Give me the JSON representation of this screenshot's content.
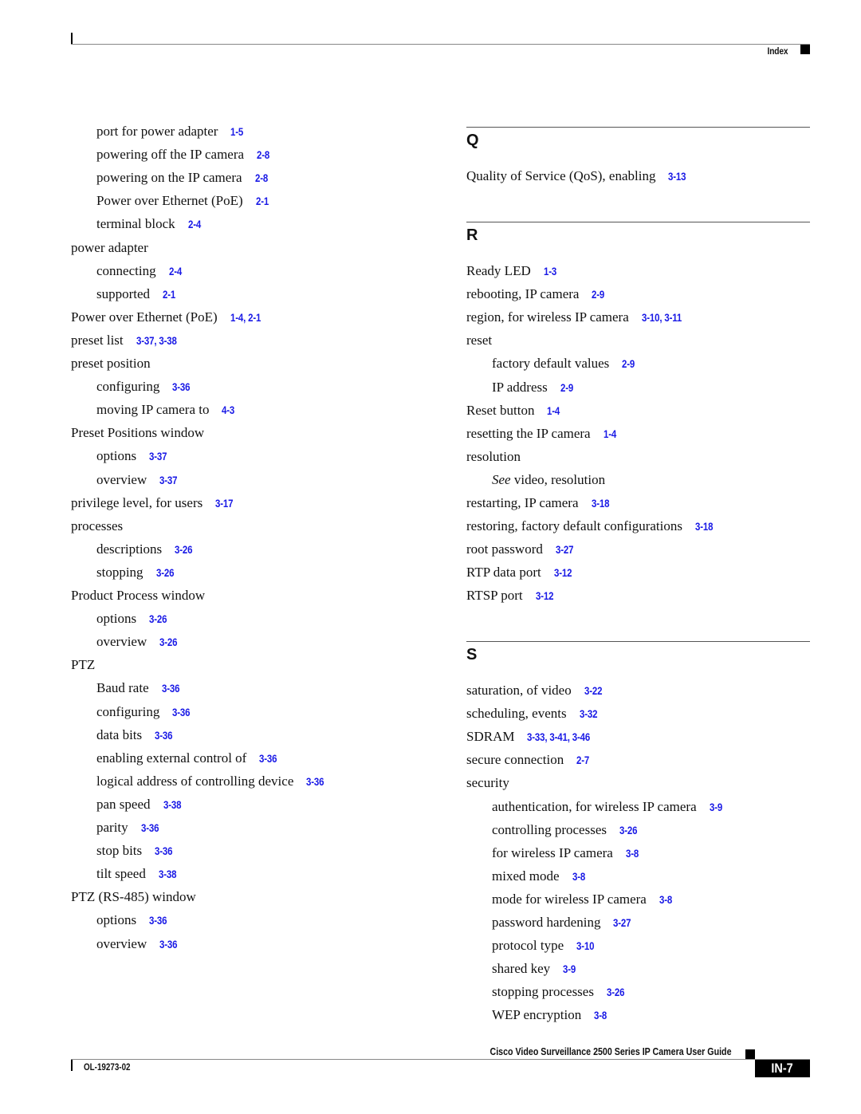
{
  "header": {
    "section_label": "Index"
  },
  "left_column": [
    {
      "text": "port for power adapter",
      "refs": "1-5",
      "level": 2
    },
    {
      "text": "powering off the IP camera",
      "refs": "2-8",
      "level": 2
    },
    {
      "text": "powering on the IP camera",
      "refs": "2-8",
      "level": 2
    },
    {
      "text": "Power over Ethernet (PoE)",
      "refs": "2-1",
      "level": 2
    },
    {
      "text": "terminal block",
      "refs": "2-4",
      "level": 2
    },
    {
      "text": "power adapter",
      "refs": "",
      "level": 1
    },
    {
      "text": "connecting",
      "refs": "2-4",
      "level": 2
    },
    {
      "text": "supported",
      "refs": "2-1",
      "level": 2
    },
    {
      "text": "Power over Ethernet (PoE)",
      "refs": "1-4, 2-1",
      "level": 1
    },
    {
      "text": "preset list",
      "refs": "3-37, 3-38",
      "level": 1
    },
    {
      "text": "preset position",
      "refs": "",
      "level": 1
    },
    {
      "text": "configuring",
      "refs": "3-36",
      "level": 2
    },
    {
      "text": "moving IP camera to",
      "refs": "4-3",
      "level": 2
    },
    {
      "text": "Preset Positions window",
      "refs": "",
      "level": 1
    },
    {
      "text": "options",
      "refs": "3-37",
      "level": 2
    },
    {
      "text": "overview",
      "refs": "3-37",
      "level": 2
    },
    {
      "text": "privilege level, for users",
      "refs": "3-17",
      "level": 1
    },
    {
      "text": "processes",
      "refs": "",
      "level": 1
    },
    {
      "text": "descriptions",
      "refs": "3-26",
      "level": 2
    },
    {
      "text": "stopping",
      "refs": "3-26",
      "level": 2
    },
    {
      "text": "Product Process window",
      "refs": "",
      "level": 1
    },
    {
      "text": "options",
      "refs": "3-26",
      "level": 2
    },
    {
      "text": "overview",
      "refs": "3-26",
      "level": 2
    },
    {
      "text": "PTZ",
      "refs": "",
      "level": 1
    },
    {
      "text": "Baud rate",
      "refs": "3-36",
      "level": 2
    },
    {
      "text": "configuring",
      "refs": "3-36",
      "level": 2
    },
    {
      "text": "data bits",
      "refs": "3-36",
      "level": 2
    },
    {
      "text": "enabling external control of",
      "refs": "3-36",
      "level": 2
    },
    {
      "text": "logical address of controlling device",
      "refs": "3-36",
      "level": 2
    },
    {
      "text": "pan speed",
      "refs": "3-38",
      "level": 2
    },
    {
      "text": "parity",
      "refs": "3-36",
      "level": 2
    },
    {
      "text": "stop bits",
      "refs": "3-36",
      "level": 2
    },
    {
      "text": "tilt speed",
      "refs": "3-38",
      "level": 2
    },
    {
      "text": "PTZ (RS-485) window",
      "refs": "",
      "level": 1
    },
    {
      "text": "options",
      "refs": "3-36",
      "level": 2
    },
    {
      "text": "overview",
      "refs": "3-36",
      "level": 2
    }
  ],
  "sections": {
    "Q": {
      "letter": "Q",
      "entries": [
        {
          "text": "Quality of Service (QoS), enabling",
          "refs": "3-13",
          "level": 1
        }
      ]
    },
    "R": {
      "letter": "R",
      "entries": [
        {
          "text": "Ready LED",
          "refs": "1-3",
          "level": 1
        },
        {
          "text": "rebooting, IP camera",
          "refs": "2-9",
          "level": 1
        },
        {
          "text": "region, for wireless IP camera",
          "refs": "3-10, 3-11",
          "level": 1
        },
        {
          "text": "reset",
          "refs": "",
          "level": 1
        },
        {
          "text": "factory default values",
          "refs": "2-9",
          "level": 2
        },
        {
          "text": "IP address",
          "refs": "2-9",
          "level": 2
        },
        {
          "text": "Reset button",
          "refs": "1-4",
          "level": 1
        },
        {
          "text": "resetting the IP camera",
          "refs": "1-4",
          "level": 1
        },
        {
          "text": "resolution",
          "refs": "",
          "level": 1
        },
        {
          "text": "video, resolution",
          "see": "See",
          "refs": "",
          "level": 2
        },
        {
          "text": "restarting, IP camera",
          "refs": "3-18",
          "level": 1
        },
        {
          "text": "restoring, factory default configurations",
          "refs": "3-18",
          "level": 1
        },
        {
          "text": "root password",
          "refs": "3-27",
          "level": 1
        },
        {
          "text": "RTP data port",
          "refs": "3-12",
          "level": 1
        },
        {
          "text": "RTSP port",
          "refs": "3-12",
          "level": 1
        }
      ]
    },
    "S": {
      "letter": "S",
      "entries": [
        {
          "text": "saturation, of video",
          "refs": "3-22",
          "level": 1
        },
        {
          "text": "scheduling, events",
          "refs": "3-32",
          "level": 1
        },
        {
          "text": "SDRAM",
          "refs": "3-33, 3-41, 3-46",
          "level": 1
        },
        {
          "text": "secure connection",
          "refs": "2-7",
          "level": 1
        },
        {
          "text": "security",
          "refs": "",
          "level": 1
        },
        {
          "text": "authentication, for wireless IP camera",
          "refs": "3-9",
          "level": 2
        },
        {
          "text": "controlling processes",
          "refs": "3-26",
          "level": 2
        },
        {
          "text": "for wireless IP camera",
          "refs": "3-8",
          "level": 2
        },
        {
          "text": "mixed mode",
          "refs": "3-8",
          "level": 2
        },
        {
          "text": "mode for wireless IP camera",
          "refs": "3-8",
          "level": 2
        },
        {
          "text": "password hardening",
          "refs": "3-27",
          "level": 2
        },
        {
          "text": "protocol type",
          "refs": "3-10",
          "level": 2
        },
        {
          "text": "shared key",
          "refs": "3-9",
          "level": 2
        },
        {
          "text": "stopping processes",
          "refs": "3-26",
          "level": 2
        },
        {
          "text": "WEP encryption",
          "refs": "3-8",
          "level": 2
        }
      ]
    }
  },
  "footer": {
    "book_title": "Cisco Video Surveillance 2500 Series IP Camera User Guide",
    "doc_number": "OL-19273-02",
    "page_number": "IN-7"
  },
  "colors": {
    "link": "#1a1ae6",
    "text": "#111111",
    "rule": "#555555"
  }
}
